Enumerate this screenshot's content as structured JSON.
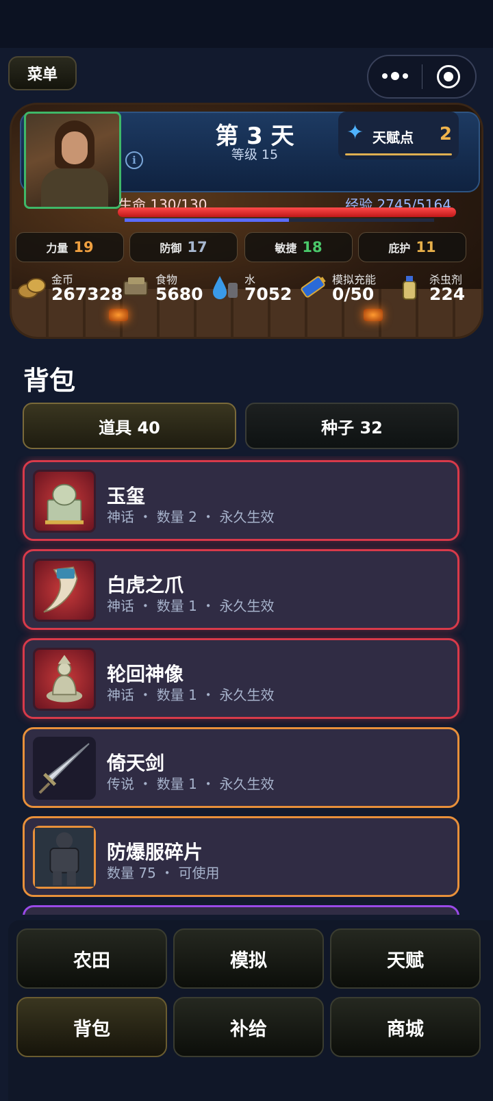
{
  "menu_label": "菜单",
  "header": {
    "day_title": "第 3 天",
    "level": "等级 15",
    "talent_label": "天赋点",
    "talent_value": "2",
    "hp_label": "生命 130/130",
    "hp_fraction": 1.0,
    "exp_label": "经验 2745/5164",
    "exp_fraction": 0.53
  },
  "stats": [
    {
      "name": "力量",
      "value": "19",
      "color": "#f0a040"
    },
    {
      "name": "防御",
      "value": "17",
      "color": "#a8b8d0"
    },
    {
      "name": "敏捷",
      "value": "18",
      "color": "#4ac86a"
    },
    {
      "name": "庇护",
      "value": "11",
      "color": "#e8b04a"
    }
  ],
  "resources": [
    {
      "name": "金币",
      "value": "267328",
      "icon": "coins-icon"
    },
    {
      "name": "食物",
      "value": "5680",
      "icon": "food-icon"
    },
    {
      "name": "水",
      "value": "7052",
      "icon": "water-icon"
    },
    {
      "name": "模拟充能",
      "value": "0/50",
      "icon": "battery-icon"
    },
    {
      "name": "杀虫剂",
      "value": "224",
      "icon": "spray-icon"
    }
  ],
  "bag": {
    "title": "背包",
    "tabs": [
      {
        "label": "道具 40",
        "active": true
      },
      {
        "label": "种子 32",
        "active": false
      }
    ],
    "items": [
      {
        "name": "玉玺",
        "meta": "神话 ・ 数量 2 ・ 永久生效",
        "rarity": "mythic",
        "icon": "jade-seal-icon"
      },
      {
        "name": "白虎之爪",
        "meta": "神话 ・ 数量 1 ・ 永久生效",
        "rarity": "mythic",
        "icon": "tiger-claw-icon"
      },
      {
        "name": "轮回神像",
        "meta": "神话 ・ 数量 1 ・ 永久生效",
        "rarity": "mythic",
        "icon": "statue-icon"
      },
      {
        "name": "倚天剑",
        "meta": "传说 ・ 数量 1 ・ 永久生效",
        "rarity": "legend",
        "icon": "sword-icon"
      },
      {
        "name": "防爆服碎片",
        "meta": "数量 75 ・ 可使用",
        "rarity": "legend",
        "icon": "armor-icon"
      }
    ]
  },
  "nav": [
    "农田",
    "模拟",
    "天赋",
    "背包",
    "补给",
    "商城"
  ],
  "nav_active": "背包"
}
